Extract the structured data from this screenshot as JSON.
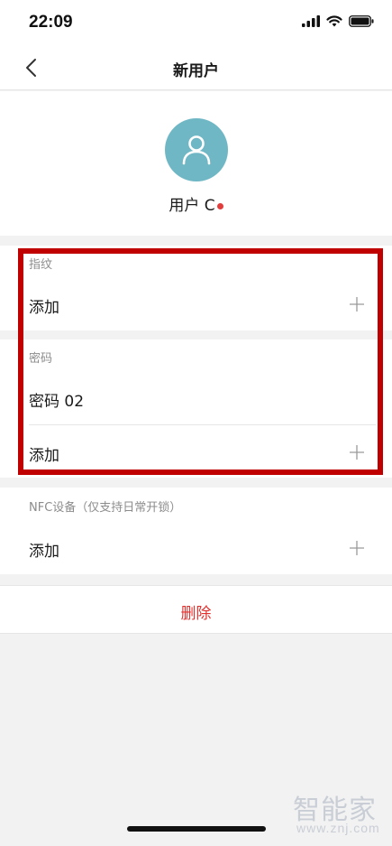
{
  "status_bar": {
    "time": "22:09"
  },
  "nav": {
    "title": "新用户"
  },
  "profile": {
    "name": "用户 C"
  },
  "fingerprint": {
    "label": "指纹",
    "add_label": "添加"
  },
  "password": {
    "label": "密码",
    "items": [
      "密码 02"
    ],
    "add_label": "添加"
  },
  "nfc": {
    "label": "NFC设备（仅支持日常开锁）",
    "add_label": "添加"
  },
  "delete": {
    "label": "删除"
  },
  "watermark": {
    "logo": "智能家",
    "url": "www.znj.com"
  },
  "colors": {
    "avatar_bg": "#6fb7c5",
    "danger": "#e0312f",
    "highlight": "#c00000"
  },
  "icons": {
    "back": "chevron-left-icon",
    "avatar": "user-icon",
    "add": "plus-icon"
  }
}
